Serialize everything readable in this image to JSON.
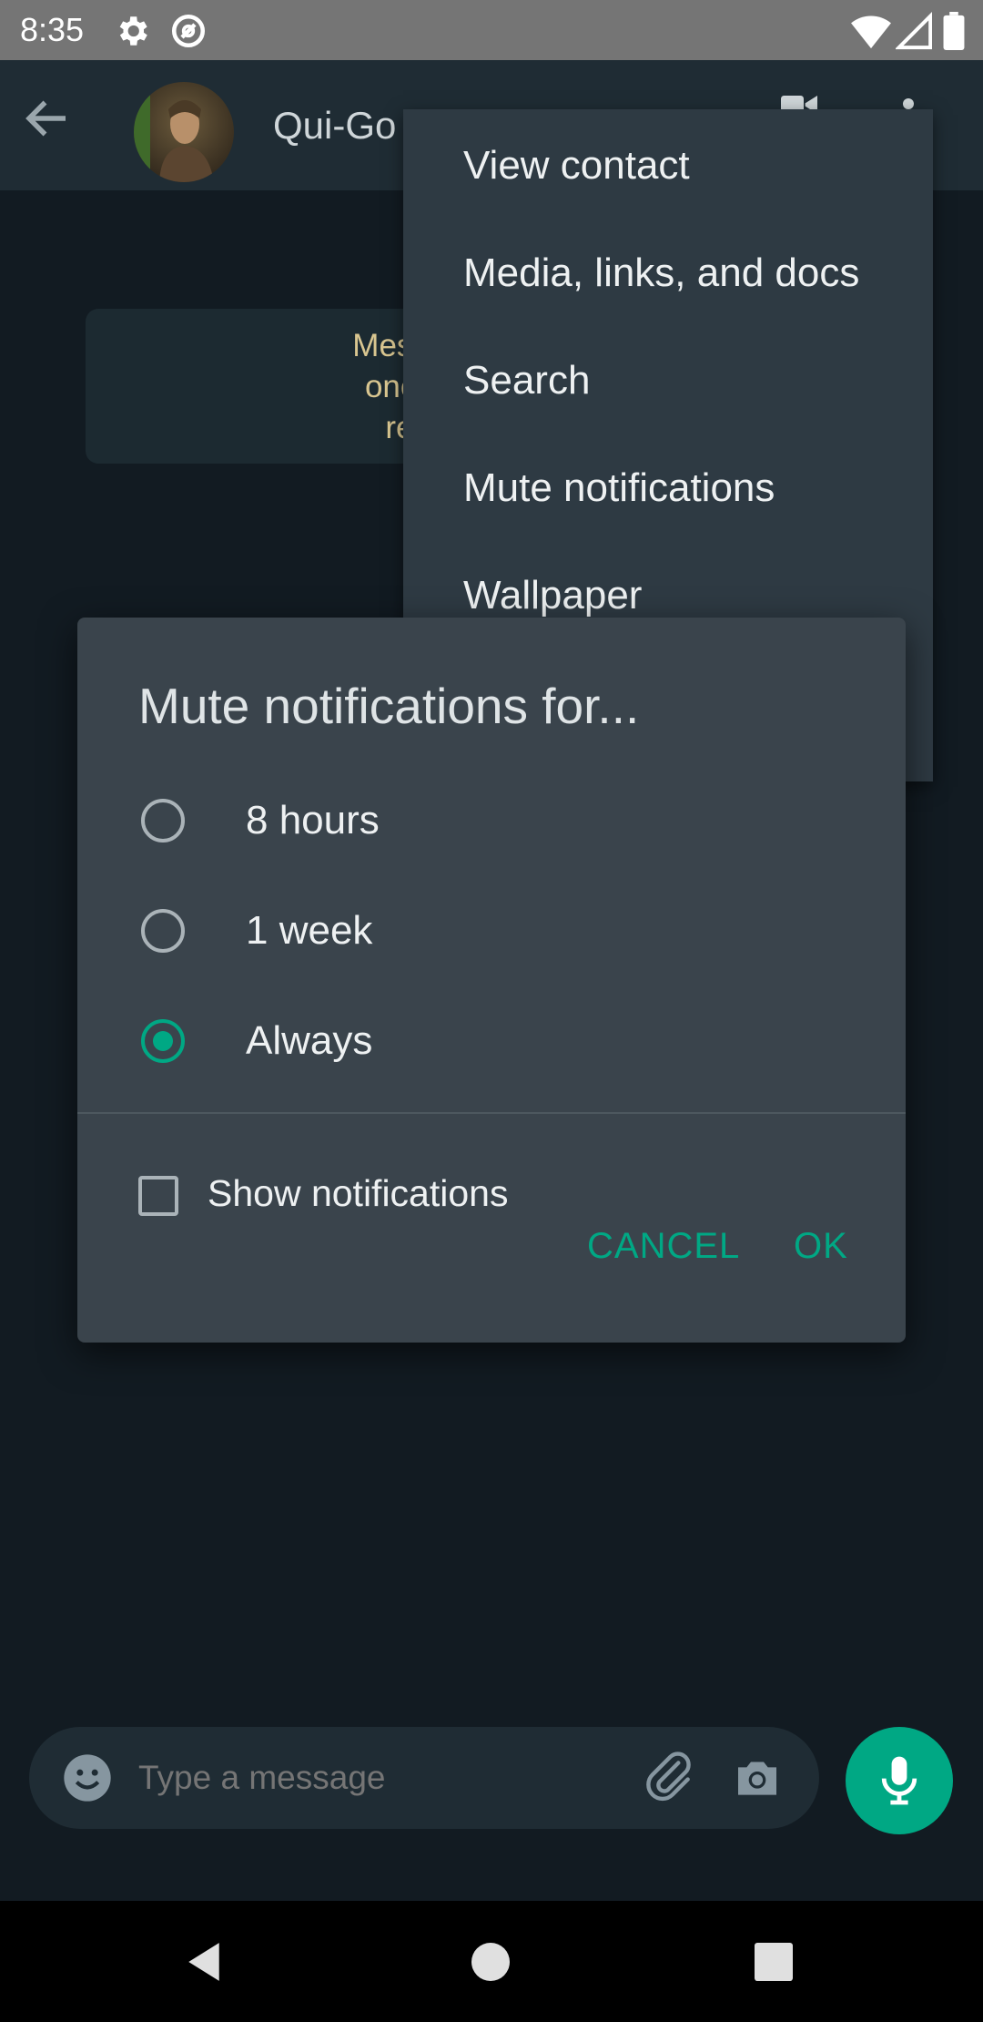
{
  "status_bar": {
    "time": "8:35",
    "icons": [
      "gear-icon",
      "sync-icon",
      "wifi-icon",
      "signal-icon",
      "battery-icon"
    ]
  },
  "app_bar": {
    "contact_name": "Qui-Go",
    "icons": [
      "back-arrow-icon",
      "video-call-icon",
      "more-vert-icon"
    ]
  },
  "encryption_notice": {
    "lines": [
      "Messages and calls",
      "one outside of this",
      "read or listen to"
    ]
  },
  "menu": {
    "items": [
      "View contact",
      "Media, links, and docs",
      "Search",
      "Mute notifications",
      "Wallpaper"
    ]
  },
  "dialog": {
    "title": "Mute notifications for...",
    "options": [
      {
        "label": "8 hours",
        "selected": false
      },
      {
        "label": "1 week",
        "selected": false
      },
      {
        "label": "Always",
        "selected": true
      }
    ],
    "checkbox_label": "Show notifications",
    "checkbox_checked": false,
    "cancel_label": "CANCEL",
    "ok_label": "OK"
  },
  "composer": {
    "placeholder": "Type a message",
    "icons": [
      "emoji-icon",
      "attach-icon",
      "camera-icon",
      "mic-icon"
    ]
  },
  "nav_bar": {
    "icons": [
      "back-triangle-icon",
      "home-circle-icon",
      "recents-square-icon"
    ]
  },
  "colors": {
    "accent": "#00a884",
    "background": "#121b22",
    "dialog": "#3a444c",
    "menu": "#2e3a43",
    "notice_text": "#d9c690"
  }
}
